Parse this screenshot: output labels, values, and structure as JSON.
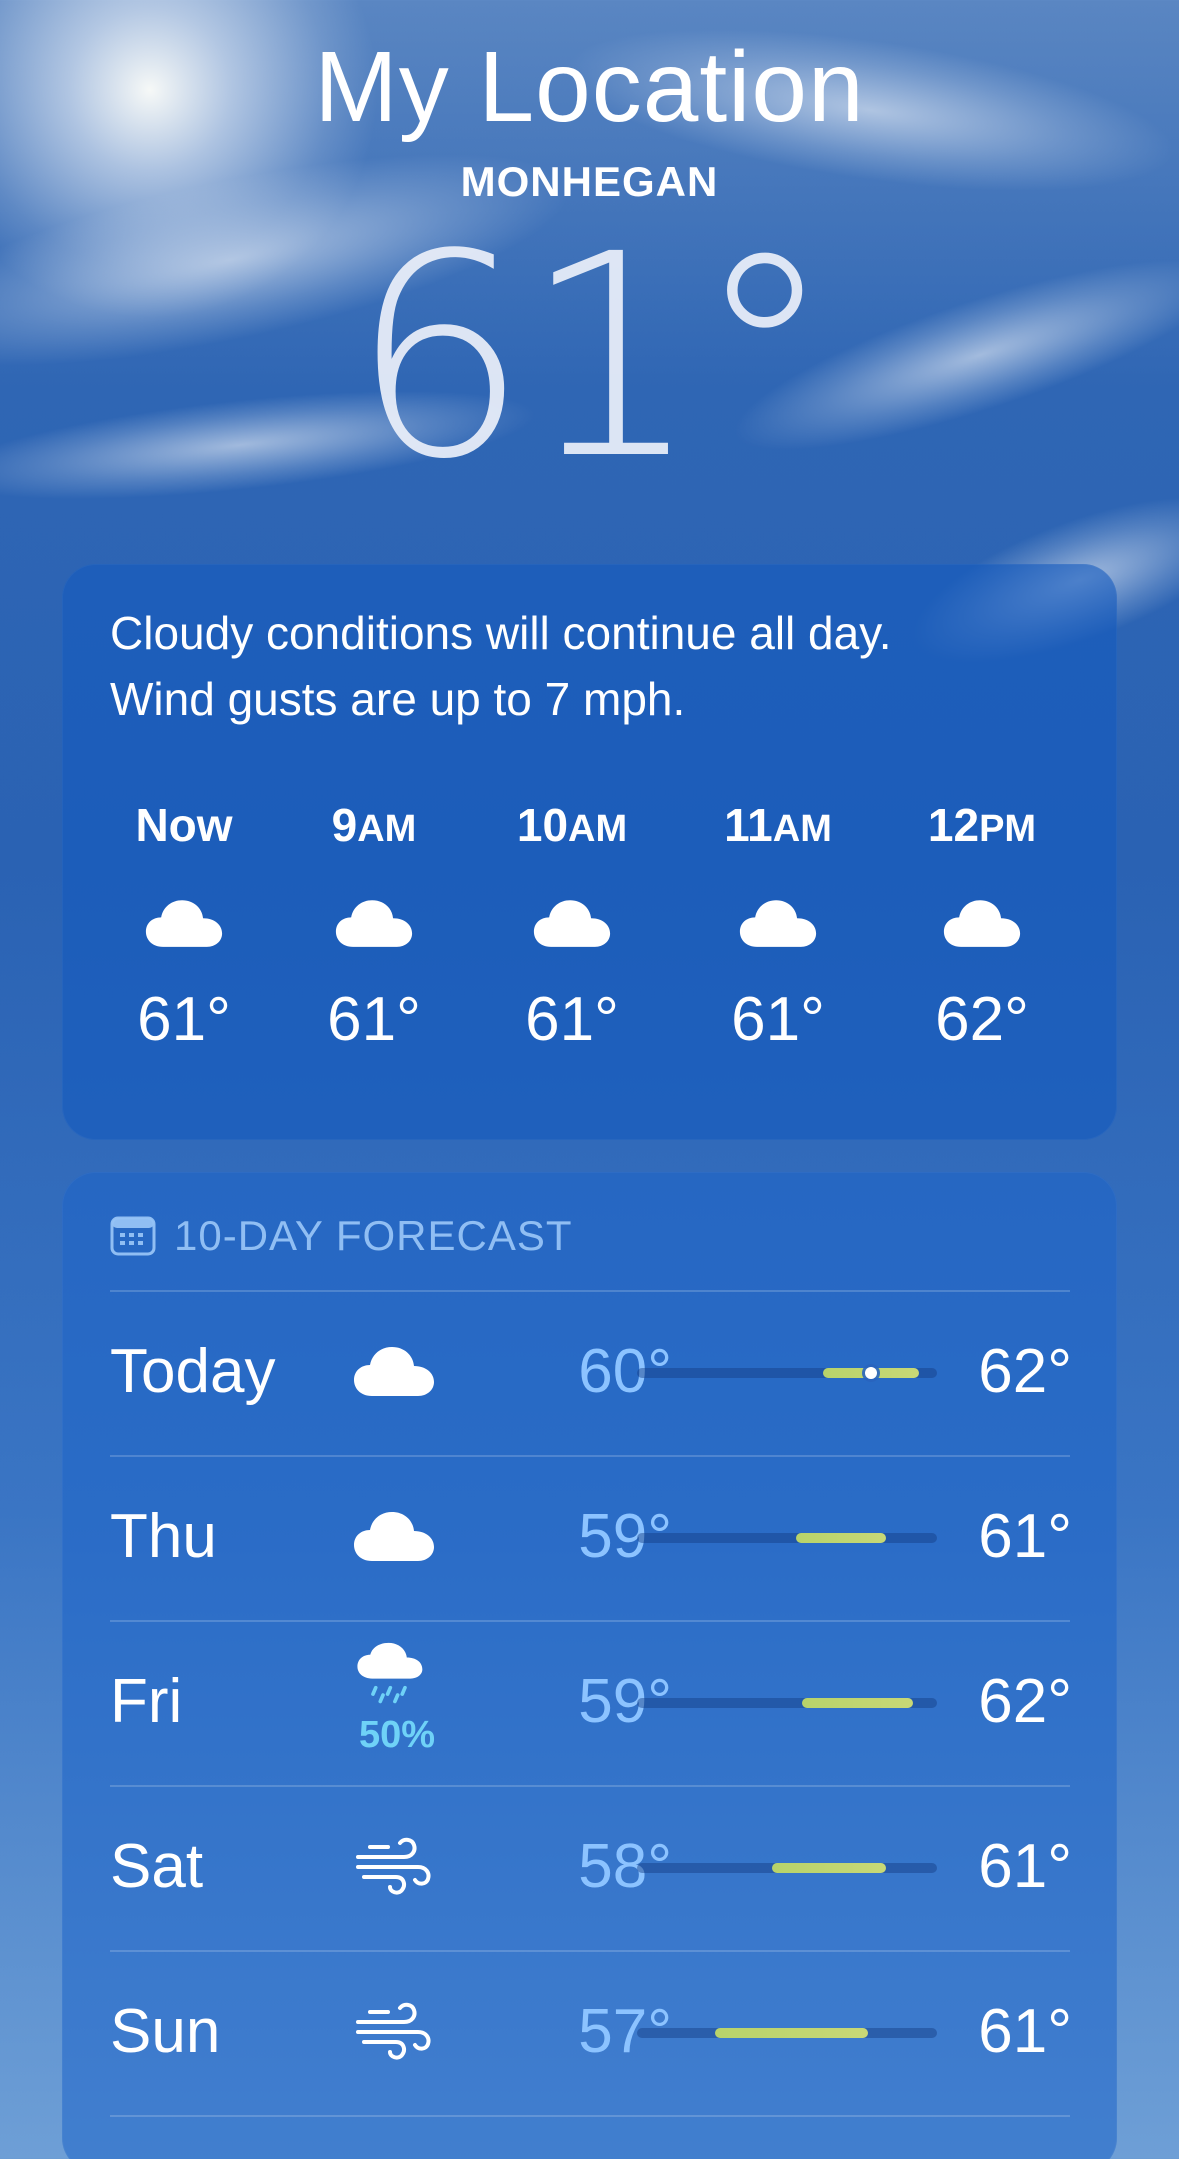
{
  "header": {
    "title": "My Location",
    "place": "MONHEGAN",
    "current_temp": "61°"
  },
  "hourly": {
    "summary_line1": "Cloudy conditions will continue all day.",
    "summary_line2": "Wind gusts are up to 7 mph.",
    "hours": [
      {
        "hour": "Now",
        "ampm": "",
        "icon": "cloud-icon",
        "temp": "61°"
      },
      {
        "hour": "9",
        "ampm": "AM",
        "icon": "cloud-icon",
        "temp": "61°"
      },
      {
        "hour": "10",
        "ampm": "AM",
        "icon": "cloud-icon",
        "temp": "61°"
      },
      {
        "hour": "11",
        "ampm": "AM",
        "icon": "cloud-icon",
        "temp": "61°"
      },
      {
        "hour": "12",
        "ampm": "PM",
        "icon": "cloud-icon",
        "temp": "62°"
      }
    ]
  },
  "forecast": {
    "header_label": "10-DAY FORECAST",
    "header_icon": "calendar-icon",
    "days": [
      {
        "day": "Today",
        "icon": "cloud-icon",
        "precip": "",
        "low": "60°",
        "high": "62°",
        "bar_start": 0.62,
        "bar_end": 0.94,
        "current": 0.78
      },
      {
        "day": "Thu",
        "icon": "cloud-icon",
        "precip": "",
        "low": "59°",
        "high": "61°",
        "bar_start": 0.53,
        "bar_end": 0.83,
        "current": null
      },
      {
        "day": "Fri",
        "icon": "cloud-rain-icon",
        "precip": "50%",
        "low": "59°",
        "high": "62°",
        "bar_start": 0.55,
        "bar_end": 0.92,
        "current": null
      },
      {
        "day": "Sat",
        "icon": "wind-icon",
        "precip": "",
        "low": "58°",
        "high": "61°",
        "bar_start": 0.45,
        "bar_end": 0.83,
        "current": null
      },
      {
        "day": "Sun",
        "icon": "wind-icon",
        "precip": "",
        "low": "57°",
        "high": "61°",
        "bar_start": 0.26,
        "bar_end": 0.77,
        "current": null
      }
    ]
  },
  "colors": {
    "low_temp": "#8cc3ff",
    "bar_fill": "#b8d36a",
    "precip": "#6fd2f7"
  }
}
